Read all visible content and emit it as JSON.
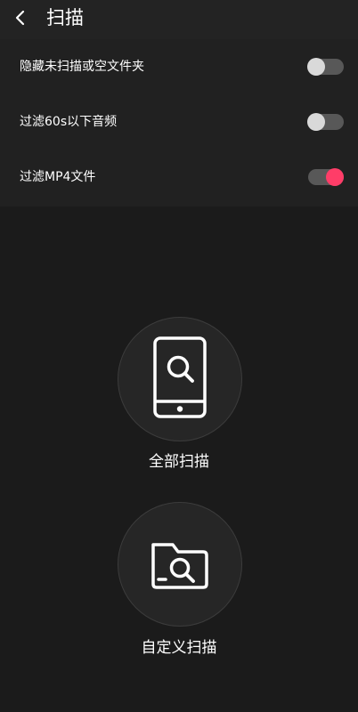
{
  "header": {
    "title": "扫描",
    "back_icon": "chevron-left-icon"
  },
  "settings": [
    {
      "label": "隐藏未扫描或空文件夹",
      "enabled": false
    },
    {
      "label": "过滤60s以下音频",
      "enabled": false
    },
    {
      "label": "过滤MP4文件",
      "enabled": true
    }
  ],
  "actions": {
    "full_scan": {
      "label": "全部扫描",
      "icon": "phone-search-icon"
    },
    "custom_scan": {
      "label": "自定义扫描",
      "icon": "folder-search-icon"
    }
  },
  "colors": {
    "accent": "#ff3d68",
    "background": "#1b1b1b",
    "panel": "#212121"
  }
}
